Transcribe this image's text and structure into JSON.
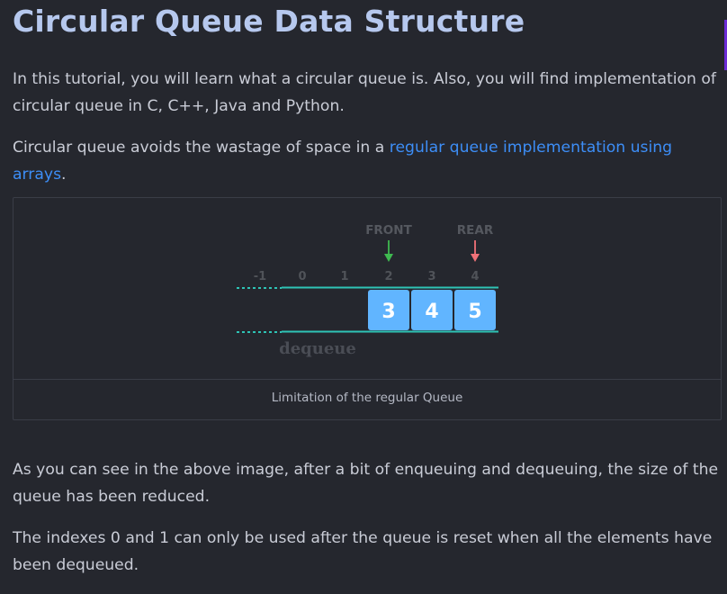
{
  "page": {
    "title": "Circular Queue Data Structure",
    "intro": "In this tutorial, you will learn what a circular queue is. Also, you will find implementation of circular queue in C, C++, Java and Python.",
    "p2_prefix": "Circular queue avoids the wastage of space in a ",
    "p2_link": "regular queue implementation using arrays",
    "p2_suffix": ".",
    "p3": "As you can see in the above image, after a bit of enqueuing and dequeuing, the size of the queue has been reduced.",
    "p4": "The indexes 0 and 1 can only be used after the queue is reset when all the elements have been dequeued."
  },
  "figure": {
    "front_label": "FRONT",
    "rear_label": "REAR",
    "indexes": [
      "-1",
      "0",
      "1",
      "2",
      "3",
      "4"
    ],
    "cells": [
      "3",
      "4",
      "5"
    ],
    "dequeue_label": "dequeue",
    "caption": "Limitation of the regular Queue",
    "colors": {
      "cell": "#61b5ff",
      "rail": "#2ec4b6",
      "front_arrow": "#3fb950",
      "rear_arrow": "#f07178"
    }
  }
}
